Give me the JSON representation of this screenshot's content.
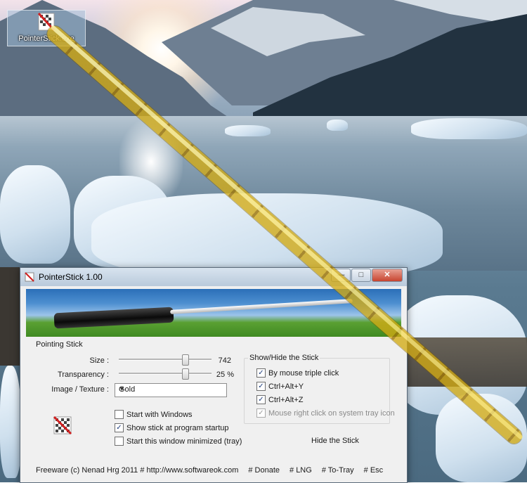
{
  "desktop": {
    "icon_label": "PointerStick.exe"
  },
  "window": {
    "title": "PointerStick 1.00",
    "controls": {
      "minimize": "—",
      "maximize": "□",
      "close": "✕"
    },
    "pointing_group_label": "Pointing Stick",
    "size": {
      "label": "Size :",
      "value": "742",
      "level_percent": 72
    },
    "transparency": {
      "label": "Transparency :",
      "value": "25 %",
      "level_percent": 72
    },
    "texture": {
      "label": "Image / Texture :",
      "value": "Gold"
    },
    "checkboxes": [
      {
        "label": "Start with Windows",
        "checked": false
      },
      {
        "label": "Show stick at program startup",
        "checked": true
      },
      {
        "label": "Start this window minimized (tray)",
        "checked": false
      }
    ],
    "showhide_group_label": "Show/Hide the Stick",
    "showhide_options": [
      {
        "label": "By mouse triple click",
        "checked": true,
        "enabled": true
      },
      {
        "label": "Ctrl+Alt+Y",
        "checked": true,
        "enabled": true
      },
      {
        "label": "Ctrl+Alt+Z",
        "checked": true,
        "enabled": true
      },
      {
        "label": "Mouse right click on system tray icon",
        "checked": true,
        "enabled": false
      }
    ],
    "hide_button": "Hide the Stick",
    "footer": {
      "copyright": "Freeware (c) Nenad Hrg 2011 # http://www.softwareok.com",
      "donate": "# Donate",
      "lng": "# LNG",
      "to_tray": "# To-Tray",
      "esc": "# Esc"
    }
  },
  "colors": {
    "stick_gold": "#d2aa14",
    "title_bar": "#c6d5e4",
    "window_bg": "#f0f0f0"
  }
}
